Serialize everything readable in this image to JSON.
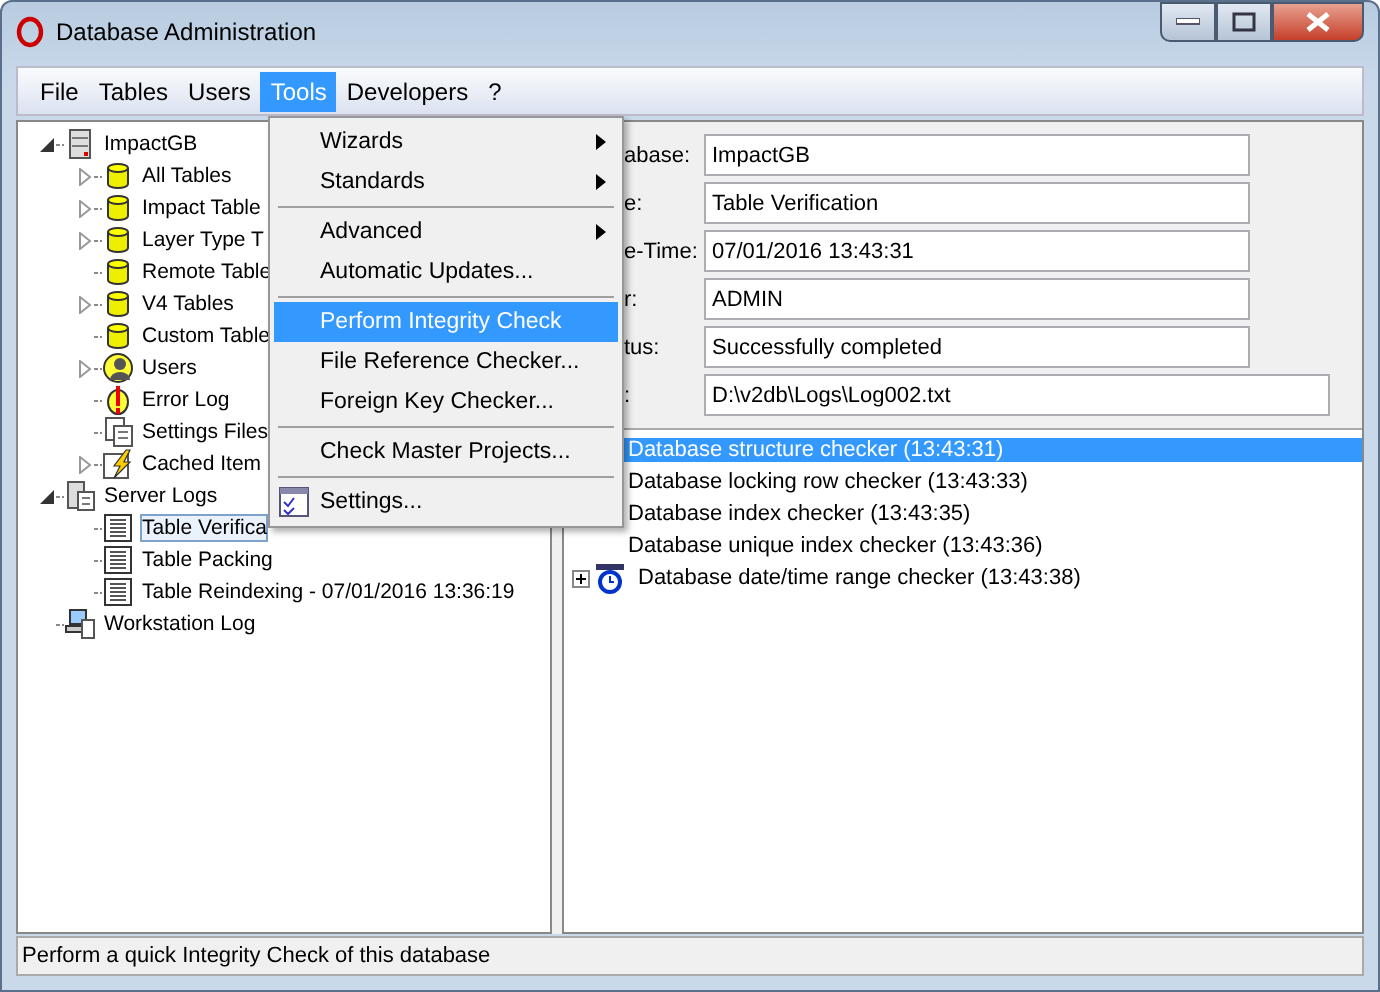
{
  "window": {
    "title": "Database Administration"
  },
  "menu_bar": [
    {
      "label": "File",
      "selected": false
    },
    {
      "label": "Tables",
      "selected": false
    },
    {
      "label": "Users",
      "selected": false
    },
    {
      "label": "Tools",
      "selected": true
    },
    {
      "label": "Developers",
      "selected": false
    },
    {
      "label": "?",
      "selected": false
    }
  ],
  "tree": [
    {
      "label": "ImpactGB",
      "kind": "server",
      "expandable": true,
      "expanded": true,
      "selected": false,
      "children": [
        {
          "label": "All Tables",
          "kind": "table",
          "expandable": true,
          "expanded": false,
          "selected": false
        },
        {
          "label": "Impact Table",
          "kind": "table",
          "expandable": true,
          "expanded": false,
          "selected": false
        },
        {
          "label": "Layer Type T",
          "kind": "table",
          "expandable": true,
          "expanded": false,
          "selected": false
        },
        {
          "label": "Remote Table",
          "kind": "table",
          "expandable": false,
          "selected": false
        },
        {
          "label": "V4 Tables",
          "kind": "table",
          "expandable": true,
          "expanded": false,
          "selected": false
        },
        {
          "label": "Custom Table",
          "kind": "table",
          "expandable": false,
          "selected": false
        },
        {
          "label": "Users",
          "kind": "users",
          "expandable": true,
          "expanded": false,
          "selected": false
        },
        {
          "label": "Error Log",
          "kind": "error",
          "expandable": false,
          "selected": false
        },
        {
          "label": "Settings Files",
          "kind": "settings",
          "expandable": false,
          "selected": false
        },
        {
          "label": "Cached Item",
          "kind": "cached",
          "expandable": true,
          "expanded": false,
          "selected": false
        }
      ]
    },
    {
      "label": "Server Logs",
      "kind": "logs",
      "expandable": true,
      "expanded": true,
      "selected": false,
      "children": [
        {
          "label": "Table Verifica",
          "kind": "doc",
          "expandable": false,
          "selected": true
        },
        {
          "label": "Table Packing",
          "kind": "doc",
          "expandable": false,
          "selected": false
        },
        {
          "label": "Table Reindexing - 07/01/2016 13:36:19",
          "kind": "doc",
          "expandable": false,
          "selected": false
        }
      ]
    },
    {
      "label": "Workstation Log",
      "kind": "workstation",
      "expandable": false,
      "selected": false
    }
  ],
  "tools_menu": [
    {
      "kind": "item",
      "label": "Wizards",
      "submenu": true,
      "selected": false
    },
    {
      "kind": "item",
      "label": "Standards",
      "submenu": true,
      "selected": false
    },
    {
      "kind": "separator"
    },
    {
      "kind": "item",
      "label": "Advanced",
      "submenu": true,
      "selected": false
    },
    {
      "kind": "item",
      "label": "Automatic Updates...",
      "submenu": false,
      "selected": false
    },
    {
      "kind": "separator"
    },
    {
      "kind": "item",
      "label": "Perform Integrity Check",
      "submenu": false,
      "selected": true
    },
    {
      "kind": "item",
      "label": "File Reference Checker...",
      "submenu": false,
      "selected": false
    },
    {
      "kind": "item",
      "label": "Foreign Key Checker...",
      "submenu": false,
      "selected": false
    },
    {
      "kind": "separator"
    },
    {
      "kind": "item",
      "label": "Check Master Projects...",
      "submenu": false,
      "selected": false
    },
    {
      "kind": "separator"
    },
    {
      "kind": "icon_item",
      "label": "Settings...",
      "submenu": false,
      "selected": false
    }
  ],
  "details": [
    {
      "label": "abase:",
      "value": "ImpactGB",
      "wide": false
    },
    {
      "label": "e:",
      "value": "Table Verification",
      "wide": false
    },
    {
      "label": "e-Time:",
      "value": "07/01/2016 13:43:31",
      "wide": false
    },
    {
      "label": "r:",
      "value": "ADMIN",
      "wide": false
    },
    {
      "label": "tus:",
      "value": "Successfully completed",
      "wide": false
    },
    {
      "label": ":",
      "value": "D:\\v2db\\Logs\\Log002.txt",
      "wide": true
    }
  ],
  "log_entries": [
    {
      "label": "Database structure checker (13:43:31)",
      "selected": true,
      "expandable": false
    },
    {
      "label": "Database locking row checker (13:43:33)",
      "selected": false,
      "expandable": false
    },
    {
      "label": "Database index checker (13:43:35)",
      "selected": false,
      "expandable": false
    },
    {
      "label": "Database unique index checker (13:43:36)",
      "selected": false,
      "expandable": false
    },
    {
      "label": "Database date/time range checker (13:43:38)",
      "selected": false,
      "expandable": true
    }
  ],
  "status_bar": {
    "text": "Perform a quick Integrity Check of this database"
  }
}
